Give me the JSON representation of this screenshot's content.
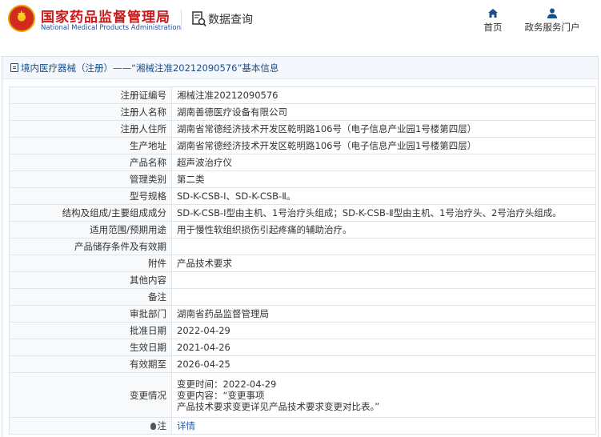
{
  "header": {
    "site_title_cn": "国家药品监督管理局",
    "site_title_en": "National Medical Products Administration",
    "query_title": "数据查询",
    "nav": [
      {
        "label": "首页",
        "icon": "home-icon"
      },
      {
        "label": "政务服务门户",
        "icon": "user-icon"
      }
    ],
    "colors": {
      "brand_red": "#c91a1a",
      "brand_blue": "#2a4f93",
      "nav_blue": "#1a4f8b"
    }
  },
  "breadcrumb": {
    "text": "境内医疗器械（注册）——“湘械注准20212090576”基本信息"
  },
  "rows": [
    {
      "key": "注册证编号",
      "value": "湘械注准20212090576"
    },
    {
      "key": "注册人名称",
      "value": "湖南善德医疗设备有限公司"
    },
    {
      "key": "注册人住所",
      "value": "湖南省常德经济技术开发区乾明路106号（电子信息产业园1号楼第四层）"
    },
    {
      "key": "生产地址",
      "value": "湖南省常德经济技术开发区乾明路106号（电子信息产业园1号楼第四层）"
    },
    {
      "key": "产品名称",
      "value": "超声波治疗仪"
    },
    {
      "key": "管理类别",
      "value": "第二类"
    },
    {
      "key": "型号规格",
      "value": "SD-K-CSB-Ⅰ、SD-K-CSB-Ⅱ。"
    },
    {
      "key": "结构及组成/主要组成成分",
      "value": "SD-K-CSB-Ⅰ型由主机、1号治疗头组成；SD-K-CSB-Ⅱ型由主机、1号治疗头、2号治疗头组成。"
    },
    {
      "key": "适用范围/预期用途",
      "value": "用于慢性软组织损伤引起疼痛的辅助治疗。"
    },
    {
      "key": "产品储存条件及有效期",
      "value": ""
    },
    {
      "key": "附件",
      "value": "产品技术要求"
    },
    {
      "key": "其他内容",
      "value": ""
    },
    {
      "key": "备注",
      "value": ""
    },
    {
      "key": "审批部门",
      "value": "湖南省药品监督管理局"
    },
    {
      "key": "批准日期",
      "value": "2022-04-29"
    },
    {
      "key": "生效日期",
      "value": "2021-04-26"
    },
    {
      "key": "有效期至",
      "value": "2026-04-25"
    }
  ],
  "change": {
    "key": "变更情况",
    "line1": "变更时间：2022-04-29",
    "line2": "变更内容：“变更事项",
    "line3": "产品技术要求变更详见产品技术要求变更对比表。”"
  },
  "note": {
    "key": "注",
    "link": "详情"
  }
}
